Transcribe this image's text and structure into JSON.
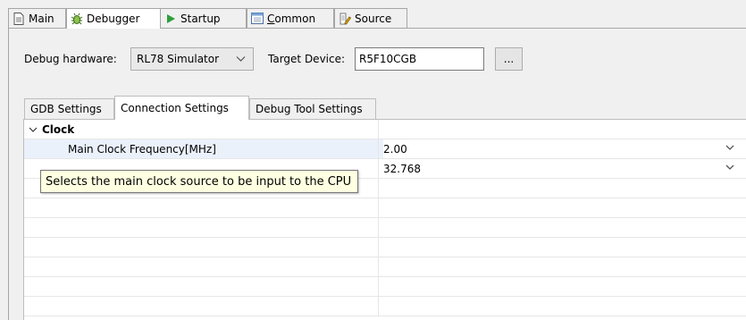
{
  "tabs": [
    {
      "label": "Main",
      "icon": "document-icon"
    },
    {
      "label": "Debugger",
      "icon": "bug-icon"
    },
    {
      "label": "Startup",
      "icon": "play-icon"
    },
    {
      "label": "Common",
      "icon": "window-icon"
    },
    {
      "label": "Source",
      "icon": "source-icon"
    }
  ],
  "debug_hardware": {
    "label": "Debug hardware:",
    "value": "RL78 Simulator"
  },
  "target_device": {
    "label": "Target Device:",
    "value": "R5F10CGB",
    "browse_label": "..."
  },
  "inner_tabs": [
    "GDB Settings",
    "Connection Settings",
    "Debug Tool Settings"
  ],
  "table": {
    "group": "Clock",
    "rows": [
      {
        "name": "Main Clock Frequency[MHz]",
        "value": "2.00"
      },
      {
        "name": "",
        "value": "32.768"
      }
    ]
  },
  "tooltip": "Selects the main clock source to be input to the CPU",
  "colors": {
    "selected_row": "#eaf1fb",
    "tooltip_bg": "#ffffe1",
    "play_icon": "#2e9e3a"
  }
}
